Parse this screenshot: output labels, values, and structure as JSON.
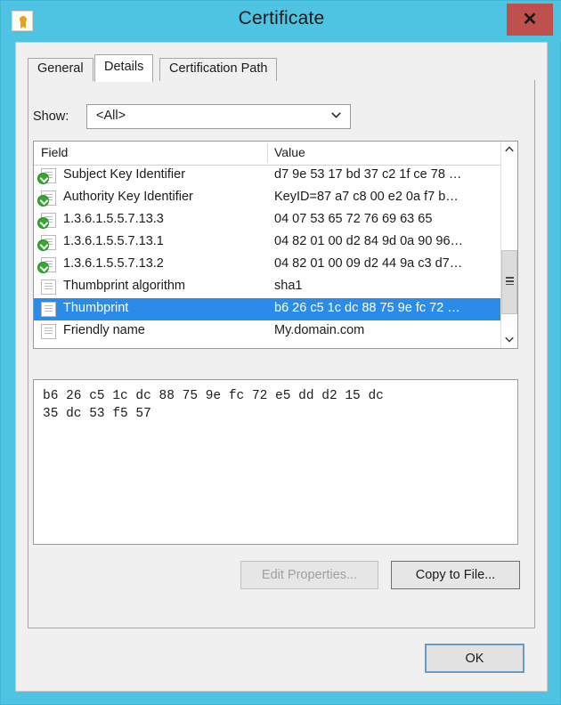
{
  "window": {
    "title": "Certificate",
    "icon": "certificate-icon",
    "close_label": "✕",
    "frame_color": "#4ec3e2",
    "close_button_color": "#c0504d"
  },
  "tabs": [
    {
      "label": "General",
      "active": false
    },
    {
      "label": "Details",
      "active": true
    },
    {
      "label": "Certification Path",
      "active": false
    }
  ],
  "show": {
    "label": "Show:",
    "value": "<All>"
  },
  "list": {
    "columns": [
      "Field",
      "Value"
    ],
    "selection_color": "#2a8ce8",
    "rows": [
      {
        "icon": "extension-icon",
        "field": "Subject Key Identifier",
        "value": "d7 9e 53 17 bd 37 c2 1f ce 78 …",
        "selected": false
      },
      {
        "icon": "extension-icon",
        "field": "Authority Key Identifier",
        "value": "KeyID=87 a7 c8 00 e2 0a f7 b…",
        "selected": false
      },
      {
        "icon": "extension-icon",
        "field": "1.3.6.1.5.5.7.13.3",
        "value": "04 07 53 65 72 76 69 63 65",
        "selected": false
      },
      {
        "icon": "extension-icon",
        "field": "1.3.6.1.5.5.7.13.1",
        "value": "04 82 01 00 d2 84 9d 0a 90 96…",
        "selected": false
      },
      {
        "icon": "extension-icon",
        "field": "1.3.6.1.5.5.7.13.2",
        "value": "04 82 01 00 09 d2 44 9a c3 d7…",
        "selected": false
      },
      {
        "icon": "property-icon",
        "field": "Thumbprint algorithm",
        "value": "sha1",
        "selected": false
      },
      {
        "icon": "property-icon",
        "field": "Thumbprint",
        "value": "b6 26 c5 1c dc 88 75 9e fc 72 …",
        "selected": true
      },
      {
        "icon": "property-icon",
        "field": "Friendly name",
        "value": "My.domain.com",
        "selected": false
      }
    ]
  },
  "detail": {
    "text": "b6 26 c5 1c dc 88 75 9e fc 72 e5 dd d2 15 dc\n35 dc 53 f5 57"
  },
  "buttons": {
    "edit_properties": "Edit Properties...",
    "copy_to_file": "Copy to File...",
    "ok": "OK"
  }
}
